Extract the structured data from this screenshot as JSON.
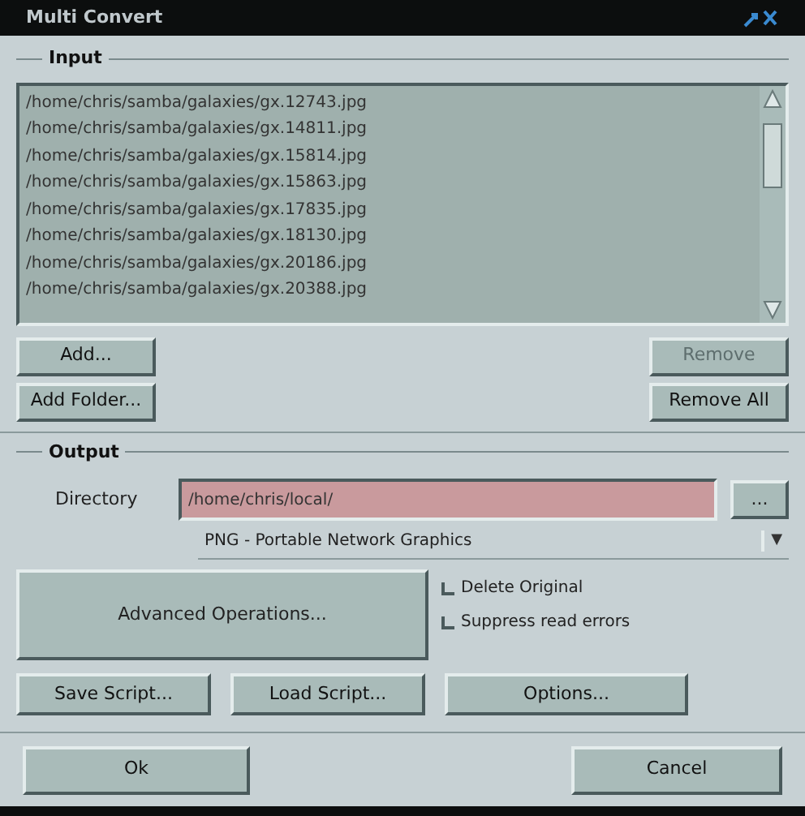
{
  "window": {
    "title": "Multi Convert"
  },
  "input": {
    "title": "Input",
    "files": [
      "/home/chris/samba/galaxies/gx.12743.jpg",
      "/home/chris/samba/galaxies/gx.14811.jpg",
      "/home/chris/samba/galaxies/gx.15814.jpg",
      "/home/chris/samba/galaxies/gx.15863.jpg",
      "/home/chris/samba/galaxies/gx.17835.jpg",
      "/home/chris/samba/galaxies/gx.18130.jpg",
      "/home/chris/samba/galaxies/gx.20186.jpg",
      "/home/chris/samba/galaxies/gx.20388.jpg"
    ],
    "left_buttons": [
      {
        "label": "Add...",
        "disabled": false
      },
      {
        "label": "Add Folder...",
        "disabled": false
      }
    ],
    "right_buttons": [
      {
        "label": "Remove",
        "disabled": true
      },
      {
        "label": "Remove All",
        "disabled": false
      }
    ]
  },
  "output": {
    "title": "Output",
    "directory_label": "Directory",
    "directory": "/home/chris/local/",
    "browse": "...",
    "format": "PNG - Portable Network Graphics",
    "format_arrow": "▼",
    "advanced": "Advanced Operations...",
    "options": [
      {
        "label": "Delete Original",
        "checked": false
      },
      {
        "label": "Suppress read errors",
        "checked": false
      }
    ],
    "script_buttons": [
      "Save Script...",
      "Load Script...",
      "Options..."
    ]
  },
  "ok": "Ok",
  "cancel": "Cancel"
}
